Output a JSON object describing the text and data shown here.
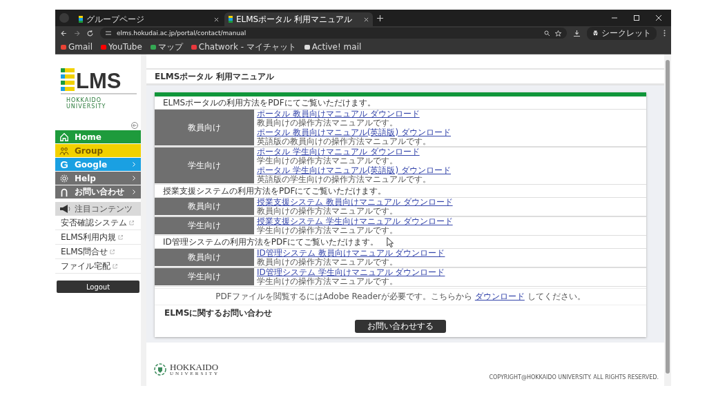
{
  "browser": {
    "tabs": [
      {
        "title": "グループページ",
        "selected": false
      },
      {
        "title": "ELMSポータル 利用マニュアル",
        "selected": true
      }
    ],
    "url": "elms.hokudai.ac.jp/portal/contact/manual",
    "profile": "シークレット",
    "bookmarks": [
      {
        "label": "Gmail",
        "color": "#ea4335"
      },
      {
        "label": "YouTube",
        "color": "#ff0000"
      },
      {
        "label": "マップ",
        "color": "#34a853"
      },
      {
        "label": "Chatwork - マイチャット",
        "color": "#e8383d"
      },
      {
        "label": "Active! mail",
        "color": "#dddddd"
      }
    ]
  },
  "sidebar": {
    "logo": {
      "letters": "LMS",
      "subtitle": "HOKKAIDO UNIVERSITY"
    },
    "nav": [
      {
        "kind": "home",
        "label": "Home",
        "color": "#1e9b3c",
        "arrow": false
      },
      {
        "kind": "group",
        "label": "Group",
        "color": "#f2d100",
        "arrow": false
      },
      {
        "kind": "google",
        "glyph": "G",
        "label": "Google",
        "color": "#1aa0e2",
        "arrow": true
      },
      {
        "kind": "help",
        "label": "Help",
        "color": "#707070",
        "arrow": true
      },
      {
        "kind": "contact",
        "label": "お問い合わせ",
        "color": "#707070",
        "arrow": true
      }
    ],
    "featured": {
      "title": "注目コンテンツ",
      "links": [
        "安否確認システム",
        "ELMS利用内規",
        "ELMS問合せ",
        "ファイル宅配"
      ]
    },
    "logout": "Logout"
  },
  "page": {
    "title": "ELMSポータル 利用マニュアル",
    "sections": [
      {
        "intro": "ELMSポータルの利用方法をPDFにてご覧いただけます。",
        "groups": [
          {
            "label": "教員向け",
            "items": [
              {
                "link": "ポータル 教員向けマニュアル ダウンロード",
                "desc": "教員向けの操作方法マニュアルです。"
              },
              {
                "link": "ポータル 教員向けマニュアル(英語版) ダウンロード",
                "desc": "英語版の教員向けの操作方法マニュアルです。"
              }
            ]
          },
          {
            "label": "学生向け",
            "items": [
              {
                "link": "ポータル 学生向けマニュアル ダウンロード",
                "desc": "学生向けの操作方法マニュアルです。"
              },
              {
                "link": "ポータル 学生向けマニュアル(英語版) ダウンロード",
                "desc": "英語版の学生向けの操作方法マニュアルです。"
              }
            ]
          }
        ]
      },
      {
        "intro": "授業支援システムの利用方法をPDFにてご覧いただけます。",
        "groups": [
          {
            "label": "教員向け",
            "items": [
              {
                "link": "授業支援システム 教員向けマニュアル ダウンロード",
                "desc": "教員向けの操作方法マニュアルです。"
              }
            ]
          },
          {
            "label": "学生向け",
            "items": [
              {
                "link": "授業支援システム 学生向けマニュアル ダウンロード",
                "desc": "学生向けの操作方法マニュアルです。"
              }
            ]
          }
        ]
      },
      {
        "intro": "ID管理システムの利用方法をPDFにてご覧いただけます。",
        "groups": [
          {
            "label": "教員向け",
            "items": [
              {
                "link": "ID管理システム 教員向けマニュアル ダウンロード",
                "desc": "教員向けの操作方法マニュアルです。"
              }
            ]
          },
          {
            "label": "学生向け",
            "items": [
              {
                "link": "ID管理システム 学生向けマニュアル ダウンロード",
                "desc": "学生向けの操作方法マニュアルです。"
              }
            ]
          }
        ]
      }
    ],
    "note": {
      "before": "PDFファイルを閲覧するにはAdobe Readerが必要です。こちらから",
      "link": "ダウンロード",
      "after": "してください。"
    },
    "contact": {
      "heading": "ELMSに関するお問い合わせ",
      "button": "お問い合わせする"
    },
    "footer": {
      "logo_main": "HOKKAIDO",
      "logo_sub": "UNIVERSITY",
      "copyright": "COPYRIGHT@HOKKAIDO UNIVERSITY. ALL RIGHTS RESERVED."
    }
  }
}
